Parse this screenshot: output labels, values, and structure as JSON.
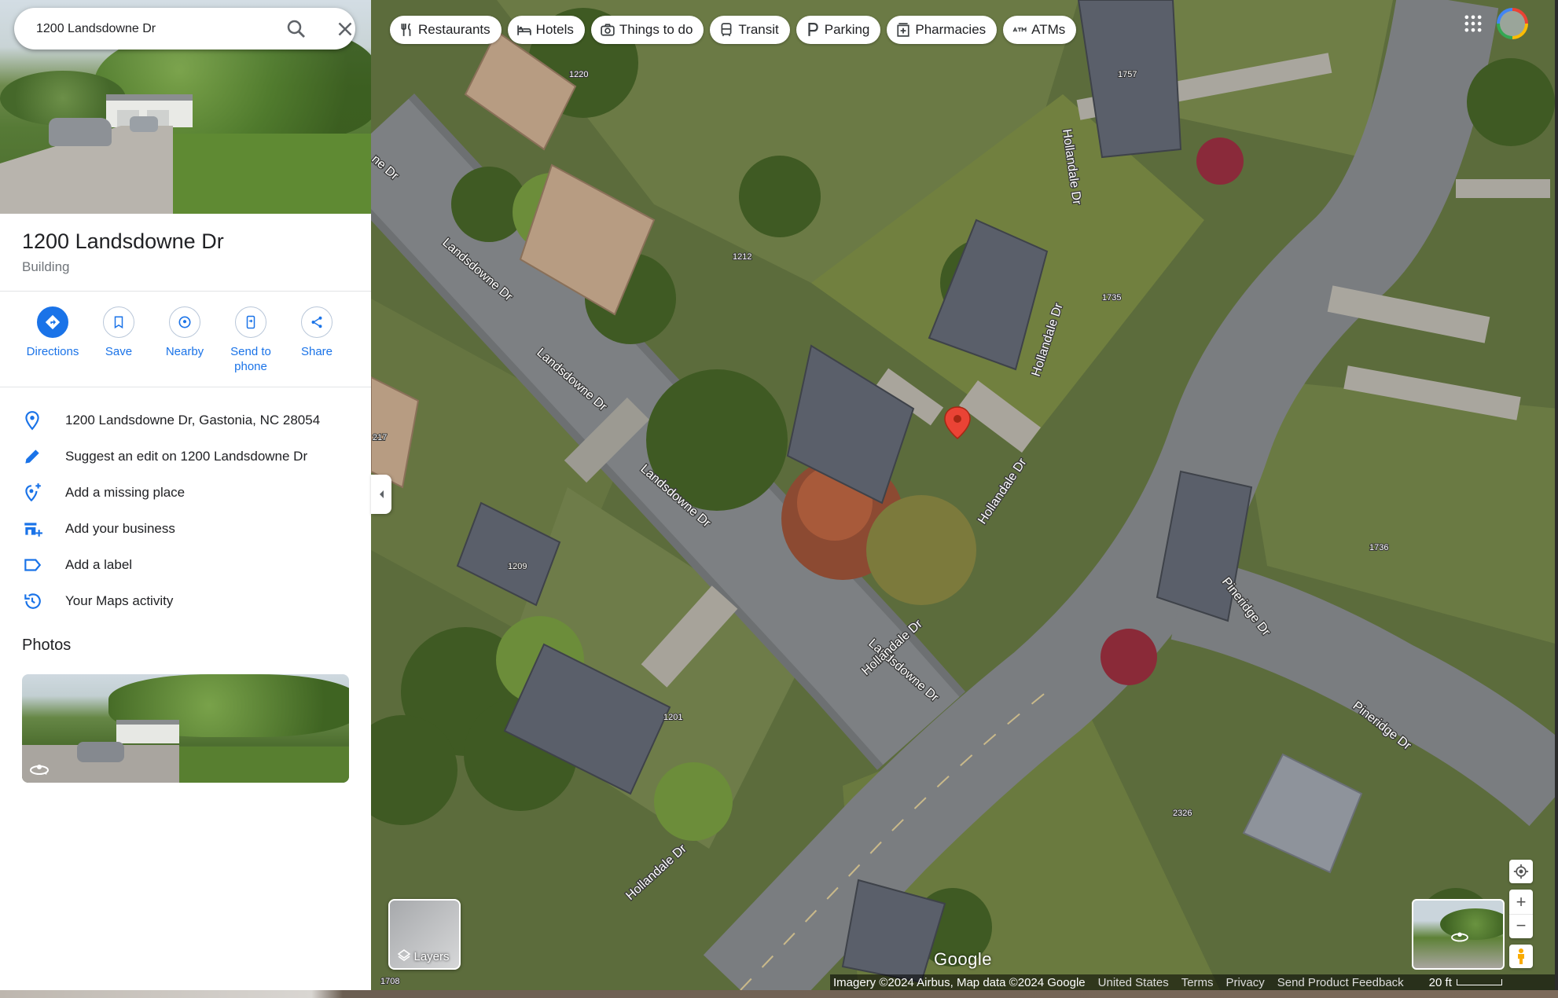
{
  "search": {
    "value": "1200 Landsdowne Dr"
  },
  "place": {
    "title": "1200 Landsdowne Dr",
    "category": "Building"
  },
  "actions": [
    {
      "label": "Directions",
      "icon": "directions-icon"
    },
    {
      "label": "Save",
      "icon": "bookmark-icon"
    },
    {
      "label": "Nearby",
      "icon": "nearby-icon"
    },
    {
      "label": "Send to\nphone",
      "icon": "send-to-phone-icon"
    },
    {
      "label": "Share",
      "icon": "share-icon"
    }
  ],
  "info_rows": [
    {
      "text": "1200 Landsdowne Dr, Gastonia, NC 28054",
      "icon": "location-pin-icon"
    },
    {
      "text": "Suggest an edit on 1200 Landsdowne Dr",
      "icon": "pencil-icon"
    },
    {
      "text": "Add a missing place",
      "icon": "add-place-icon"
    },
    {
      "text": "Add your business",
      "icon": "add-business-icon"
    },
    {
      "text": "Add a label",
      "icon": "label-icon"
    },
    {
      "text": "Your Maps activity",
      "icon": "history-icon"
    }
  ],
  "photos": {
    "heading": "Photos"
  },
  "chips": [
    {
      "label": "Restaurants",
      "icon": "restaurant-icon"
    },
    {
      "label": "Hotels",
      "icon": "hotel-icon"
    },
    {
      "label": "Things to do",
      "icon": "camera-icon"
    },
    {
      "label": "Transit",
      "icon": "transit-icon"
    },
    {
      "label": "Parking",
      "icon": "parking-icon"
    },
    {
      "label": "Pharmacies",
      "icon": "pharmacy-icon"
    },
    {
      "label": "ATMs",
      "icon": "atm-icon"
    }
  ],
  "map": {
    "road_labels": [
      "Landsdowne Dr",
      "Landsdowne Dr",
      "Landsdowne Dr",
      "Landsdowne Dr",
      "Hollandale Dr",
      "Hollandale Dr",
      "Hollandale Dr",
      "Hollandale Dr",
      "Hollandale Dr",
      "Pineridge Dr",
      "Pineridge Dr",
      "ne Dr"
    ],
    "house_numbers": [
      "1220",
      "1757",
      "1212",
      "1735",
      "1209",
      "1201",
      "1736",
      "2326",
      "217",
      "1708"
    ],
    "marker_color": "#ea4335",
    "layers_label": "Layers",
    "logo": "Google"
  },
  "footer": {
    "attribution": "Imagery ©2024 Airbus, Map data ©2024 Google",
    "links": [
      "United States",
      "Terms",
      "Privacy",
      "Send Product Feedback"
    ],
    "scale": "20 ft"
  },
  "colors": {
    "accent": "#1a73e8",
    "text": "#202124",
    "muted": "#70757a"
  }
}
